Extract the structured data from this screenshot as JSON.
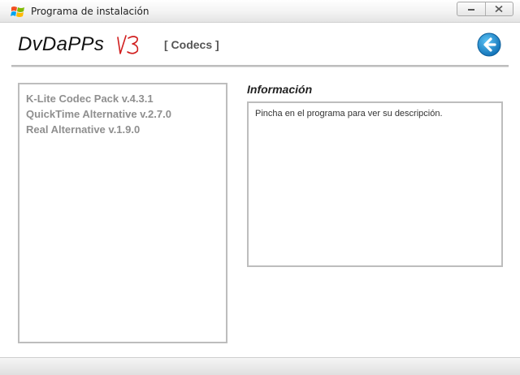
{
  "window": {
    "title": "Programa de instalación"
  },
  "header": {
    "brand": "DvDaPPs",
    "section": "[ Codecs ]"
  },
  "programs": [
    "K-Lite Codec Pack v.4.3.1",
    "QuickTime Alternative v.2.7.0",
    "Real Alternative v.1.9.0"
  ],
  "info": {
    "heading": "Información",
    "text": "Pincha en el programa para ver su descripción."
  },
  "colors": {
    "accent": "#1a8fd6",
    "v3_logo": "#d11f1f"
  },
  "icons": {
    "window": "windows-logo-icon",
    "back": "back-arrow-icon"
  }
}
